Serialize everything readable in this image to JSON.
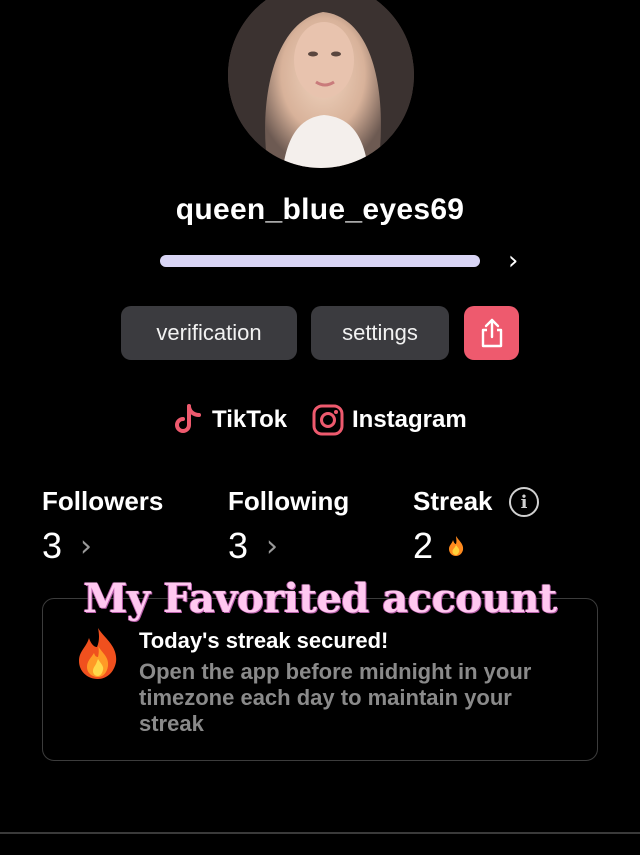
{
  "profile": {
    "username": "queen_blue_eyes69",
    "progress_fraction": 1.0
  },
  "actions": {
    "verification_label": "verification",
    "settings_label": "settings",
    "share_icon": "share-icon"
  },
  "socials": [
    {
      "label": "TikTok",
      "icon": "tiktok-icon"
    },
    {
      "label": "Instagram",
      "icon": "instagram-icon"
    }
  ],
  "stats": {
    "followers": {
      "label": "Followers",
      "value": "3"
    },
    "following": {
      "label": "Following",
      "value": "3"
    },
    "streak": {
      "label": "Streak",
      "value": "2",
      "info_glyph": "i"
    }
  },
  "overlay_caption": "My Favorited account",
  "streak_card": {
    "title": "Today's streak secured!",
    "body": "Open the app before midnight in your timezone each day to maintain your streak"
  },
  "colors": {
    "background": "#000000",
    "progress_fill": "#d9d5f5",
    "share_button": "#ee5a6e",
    "pill_button": "#3b3b3f",
    "tiktok_accent": "#ee5a6e",
    "instagram_accent": "#ee5a6e",
    "caption": "#ffc8f0"
  }
}
